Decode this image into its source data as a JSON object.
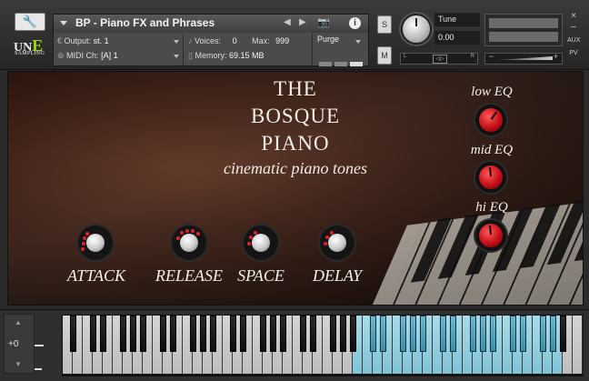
{
  "header": {
    "instrument_name": "BP - Piano FX and Phrases",
    "logo": {
      "main": "UNE",
      "sub": "SAMPLING"
    },
    "output": {
      "label": "Output:",
      "value": "st. 1"
    },
    "voices": {
      "label": "Voices:",
      "value": "0",
      "max_label": "Max:",
      "max_value": "999"
    },
    "purge": {
      "label": "Purge"
    },
    "midi": {
      "label": "MIDI Ch:",
      "value": "[A] 1"
    },
    "memory": {
      "label": "Memory:",
      "value": "69.15 MB"
    },
    "solo_label": "S",
    "mute_label": "M",
    "tune": {
      "label": "Tune",
      "value": "0.00"
    },
    "pan": {
      "left": "L",
      "right": "R"
    },
    "side": {
      "close": "×",
      "minimize": "–",
      "aux": "AUX",
      "pv": "PV"
    },
    "icons": [
      "wrench-icon",
      "camera-icon",
      "info-icon",
      "prev-arrow-icon",
      "next-arrow-icon"
    ]
  },
  "panel": {
    "title_line1": "THE",
    "title_line2": "BOSQUE",
    "title_line3": "PIANO",
    "tagline": "cinematic piano tones",
    "knobs": [
      {
        "label": "ATTACK"
      },
      {
        "label": "RELEASE"
      },
      {
        "label": "SPACE"
      },
      {
        "label": "DELAY"
      }
    ],
    "eq": [
      {
        "label": "low EQ"
      },
      {
        "label": "mid EQ"
      },
      {
        "label": "hi EQ"
      }
    ],
    "knob_color": "#c40f18",
    "dot_color": "#e0232a"
  },
  "keyboard": {
    "octave_offset": "+0",
    "highlight_color": "#8fd0e0"
  }
}
